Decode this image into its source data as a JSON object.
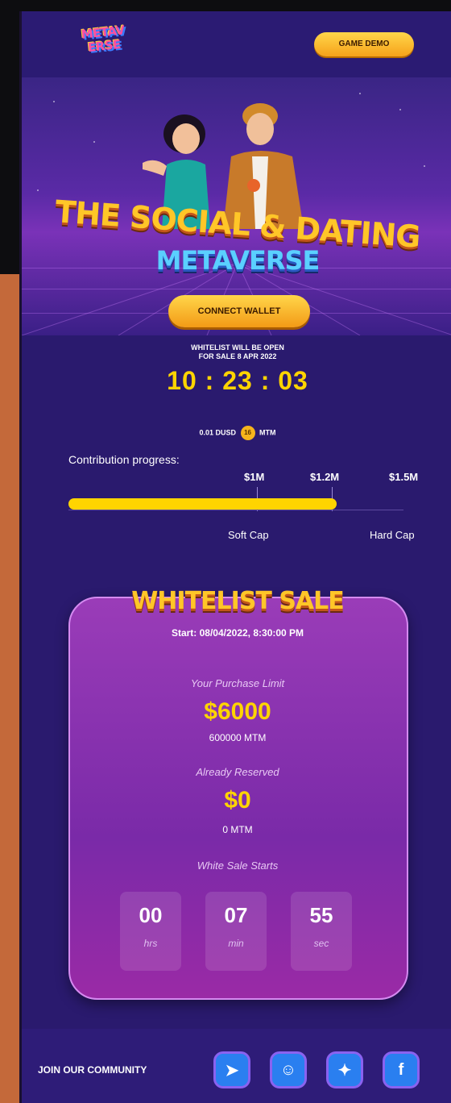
{
  "header": {
    "logo": [
      "METAV",
      "ERSE"
    ],
    "demo_label": "GAME DEMO"
  },
  "hero": {
    "title": "THE SOCIAL & DATING",
    "subtitle": "METAVERSE",
    "connect_label": "CONNECT WALLET"
  },
  "countdown": {
    "note_line1": "WHITELIST WILL BE OPEN",
    "note_line2": "FOR SALE 8 APR 2022",
    "time": "10 : 23 : 03"
  },
  "rate": {
    "left": "0.01 DUSD",
    "coin": "16",
    "right": "MTM"
  },
  "progress": {
    "label": "Contribution progress:",
    "caps": [
      "$1M",
      "$1.2M",
      "$1.5M"
    ],
    "soft_cap": "Soft Cap",
    "hard_cap": "Hard Cap",
    "fill_fraction": 0.8
  },
  "sale": {
    "heading": "WHITELIST SALE",
    "start": "Start: 08/04/2022, 8:30:00 PM",
    "limit_label": "Your Purchase Limit",
    "limit_value": "$6000",
    "limit_tokens": "600000 MTM",
    "reserved_label": "Already Reserved",
    "reserved_value": "$0",
    "reserved_tokens": "0 MTM",
    "starts_label": "White Sale Starts",
    "timer": [
      {
        "value": "00",
        "unit": "hrs"
      },
      {
        "value": "07",
        "unit": "min"
      },
      {
        "value": "55",
        "unit": "sec"
      }
    ]
  },
  "footer": {
    "join_label": "JOIN OUR COMMUNITY",
    "socials": [
      {
        "icon": "telegram-icon",
        "glyph": "➤"
      },
      {
        "icon": "reddit-icon",
        "glyph": "☺"
      },
      {
        "icon": "twitter-icon",
        "glyph": "✦"
      },
      {
        "icon": "facebook-icon",
        "glyph": "f"
      }
    ]
  },
  "colors": {
    "background": "#2a1a6e",
    "accent_yellow": "#ffd400",
    "button_gold": "#f6a21a",
    "card_purple": "#9a3cb8"
  }
}
